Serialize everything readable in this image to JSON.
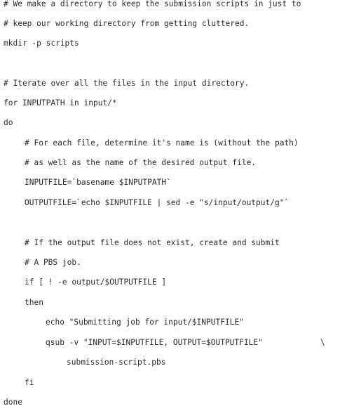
{
  "code": {
    "lines": [
      "# We make a directory to keep the submission scripts in just to",
      "# keep our working directory from getting cluttered.",
      "mkdir -p scripts",
      "# Iterate over all the files in the input directory.",
      "for INPUTPATH in input/*",
      "do",
      "# For each file, determine it's name is (without the path)",
      "# as well as the name of the desired output file.",
      "INPUTFILE=`basename $INPUTPATH`",
      "OUTPUTFILE=`echo $INPUTFILE | sed -e \"s/input/output/g\"`",
      "# If the output file does not exist, create and submit",
      "# A PBS job.",
      "if [ ! -e output/$OUTPUTFILE ]",
      "then",
      "echo \"Submitting job for input/$INPUTFILE\"",
      "qsub -v \"INPUT=$INPUTFILE, OUTPUT=$OUTPUTFILE\"",
      "submission-script.pbs",
      "fi",
      "done"
    ],
    "continuation": "\\"
  }
}
